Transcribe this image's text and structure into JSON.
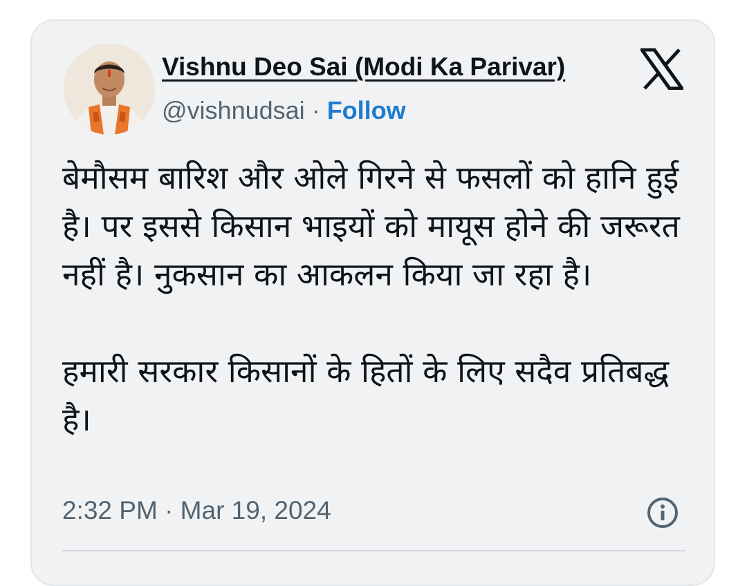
{
  "tweet": {
    "author_name": "Vishnu Deo Sai (Modi Ka Parivar)",
    "handle": "@vishnudsai",
    "separator": "·",
    "follow_label": "Follow",
    "platform_icon": "x-logo-icon",
    "avatar_icon": "profile-photo",
    "paragraph_1": "बेमौसम बारिश और ओले गिरने से फसलों को हानि हुई है। पर इससे किसान भाइयों को मायूस होने की जरूरत नहीं है। नुकसान का आकलन किया जा रहा है।",
    "paragraph_2": "हमारी सरकार किसानों के हितों के लिए सदैव प्रतिबद्ध है।",
    "timestamp": "2:32 PM · Mar 19, 2024",
    "info_icon": "info-icon"
  },
  "colors": {
    "card_background": "#f0f2f4",
    "text_primary": "#0f1419",
    "text_secondary": "#536471",
    "follow_blue": "#1d7bd0"
  }
}
